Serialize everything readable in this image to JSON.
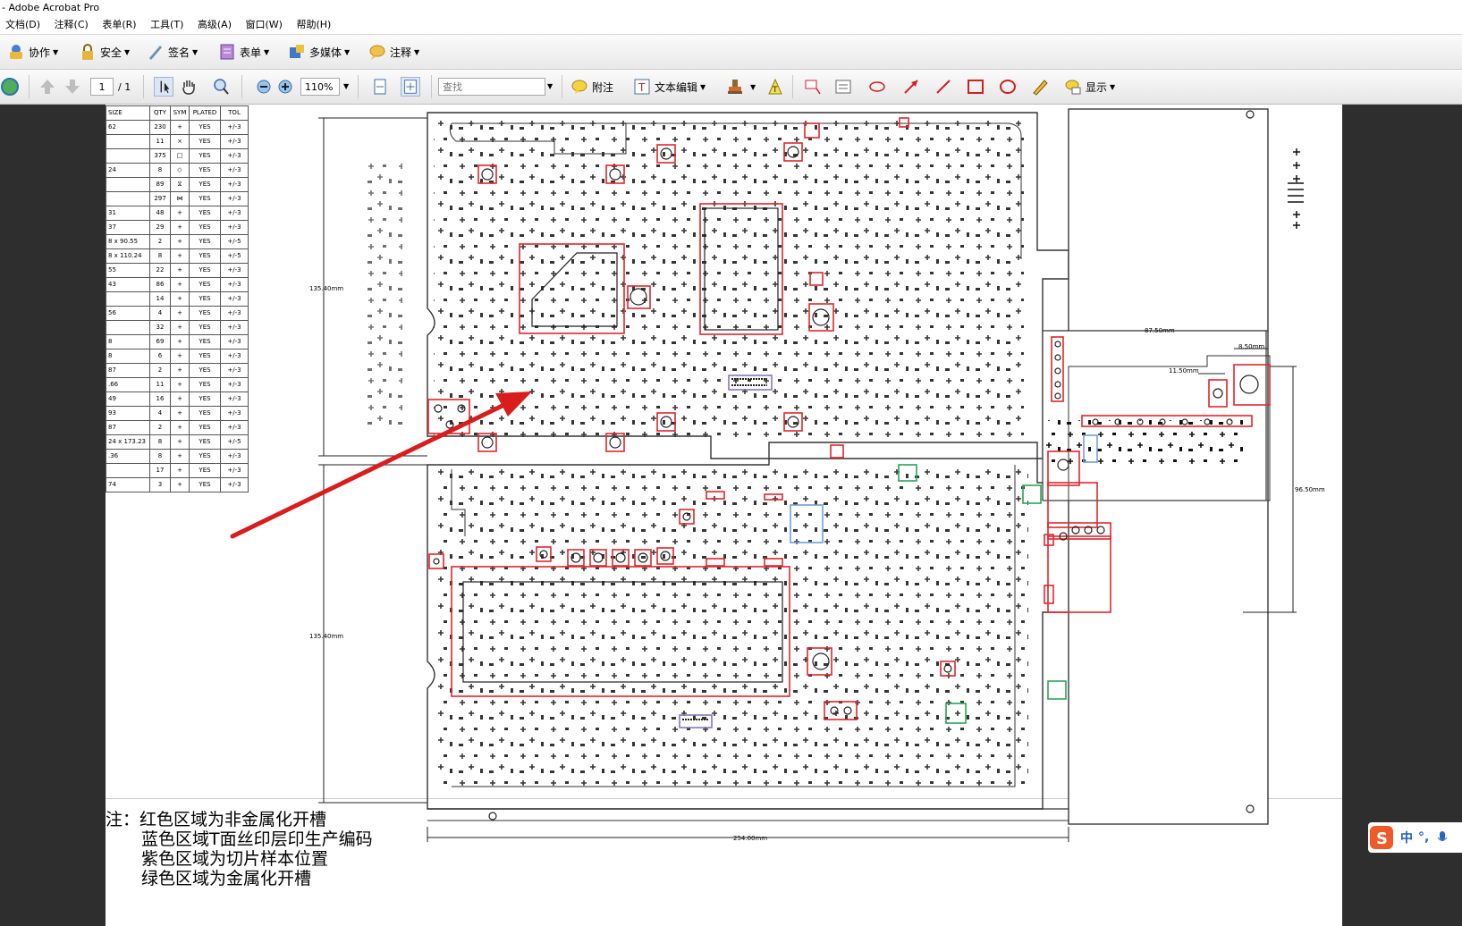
{
  "window": {
    "title": "- Adobe Acrobat Pro"
  },
  "menu": [
    "文档(D)",
    "注释(C)",
    "表单(R)",
    "工具(T)",
    "高级(A)",
    "窗口(W)",
    "帮助(H)"
  ],
  "toolbar1": {
    "collaborate": "协作",
    "security": "安全",
    "sign": "签名",
    "forms": "表单",
    "multimedia": "多媒体",
    "comment": "注释"
  },
  "toolbar2": {
    "page_current": "1",
    "page_total": "/ 1",
    "zoom": "110%",
    "find_placeholder": "查找",
    "sticky_note": "附注",
    "text_edit": "文本编辑",
    "show": "显示"
  },
  "hole_table": {
    "headers": [
      "SIZE",
      "QTY",
      "SYM",
      "PLATED",
      "TOL"
    ],
    "rows": [
      [
        "62",
        "230",
        "+",
        "YES",
        "+/-3"
      ],
      [
        "",
        "11",
        "×",
        "YES",
        "+/-3"
      ],
      [
        "",
        "375",
        "□",
        "YES",
        "+/-3"
      ],
      [
        "24",
        "8",
        "◇",
        "YES",
        "+/-3"
      ],
      [
        "",
        "89",
        "⧖",
        "YES",
        "+/-3"
      ],
      [
        "",
        "297",
        "⋈",
        "YES",
        "+/-3"
      ],
      [
        "31",
        "48",
        "+",
        "YES",
        "+/-3"
      ],
      [
        "37",
        "29",
        "+",
        "YES",
        "+/-3"
      ],
      [
        "8 x 90.55",
        "2",
        "+",
        "YES",
        "+/-5"
      ],
      [
        "8 x 110.24",
        "8",
        "+",
        "YES",
        "+/-5"
      ],
      [
        "55",
        "22",
        "+",
        "YES",
        "+/-3"
      ],
      [
        "43",
        "86",
        "+",
        "YES",
        "+/-3"
      ],
      [
        "",
        "14",
        "+",
        "YES",
        "+/-3"
      ],
      [
        "56",
        "4",
        "+",
        "YES",
        "+/-3"
      ],
      [
        "",
        "32",
        "+",
        "YES",
        "+/-3"
      ],
      [
        "8",
        "69",
        "+",
        "YES",
        "+/-3"
      ],
      [
        "8",
        "6",
        "+",
        "YES",
        "+/-3"
      ],
      [
        "87",
        "2",
        "+",
        "YES",
        "+/-3"
      ],
      [
        ".66",
        "11",
        "+",
        "YES",
        "+/-3"
      ],
      [
        "49",
        "16",
        "+",
        "YES",
        "+/-3"
      ],
      [
        "93",
        "4",
        "+",
        "YES",
        "+/-3"
      ],
      [
        "87",
        "2",
        "+",
        "YES",
        "+/-3"
      ],
      [
        "24 x 173.23",
        "8",
        "+",
        "YES",
        "+/-5"
      ],
      [
        ".36",
        "8",
        "+",
        "YES",
        "+/-3"
      ],
      [
        "",
        "17",
        "+",
        "YES",
        "+/-3"
      ],
      [
        "74",
        "3",
        "+",
        "YES",
        "+/-3"
      ]
    ]
  },
  "dimensions": {
    "panel_height_top": "135.40mm",
    "panel_height_bottom": "135.40mm",
    "total_width": "254.00mm",
    "tab_width": "87.50mm",
    "tab_small": "8.50mm",
    "tab_offset": "11.50mm",
    "tab_height": "96.50mm"
  },
  "notes": {
    "line1": "注：红色区域为非金属化开槽",
    "line2": "蓝色区域T面丝印层印生产编码",
    "line3": "紫色区域为切片样本位置",
    "line4": "绿色区域为金属化开槽"
  },
  "ime": {
    "label": "中"
  },
  "colors": {
    "red": "#e0262c",
    "blue": "#6f9fd6",
    "purple": "#8b76b8",
    "green": "#2aa35a",
    "arrow": "#d91c1c"
  }
}
